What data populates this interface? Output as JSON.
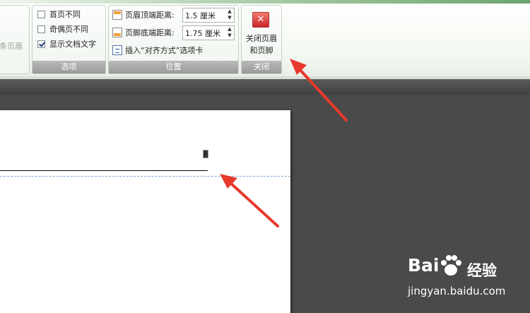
{
  "ribbon": {
    "nav_group": {
      "partial_label": "条页眉"
    },
    "options_group": {
      "label": "选项",
      "checkboxes": [
        {
          "label": "首页不同",
          "checked": false
        },
        {
          "label": "奇偶页不同",
          "checked": false
        },
        {
          "label": "显示文档文字",
          "checked": true
        }
      ]
    },
    "position_group": {
      "label": "位置",
      "header_top_label": "页眉顶端距离:",
      "header_top_value": "1.5 厘米",
      "footer_bottom_label": "页脚底端距离:",
      "footer_bottom_value": "1.75 厘米",
      "insert_tab_label": "插入“对齐方式”选项卡"
    },
    "close_group": {
      "label": "关闭",
      "button_line1": "关闭页眉",
      "button_line2": "和页脚",
      "button_icon": "✕"
    }
  },
  "watermark": {
    "brand": "Bai",
    "brand_suffix": "经验",
    "url": "jingyan.baidu.com"
  },
  "colors": {
    "accent": "#6aa56d",
    "annotation_arrow": "#e8392c",
    "workspace": "#4a4a4a"
  }
}
